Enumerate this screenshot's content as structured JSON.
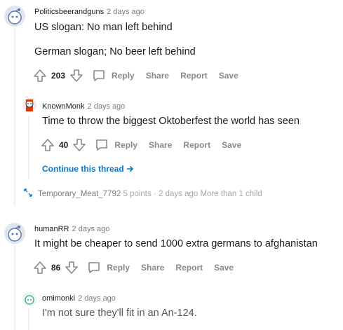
{
  "comments": [
    {
      "user": "Politicsbeerandguns",
      "time": "2 days ago",
      "body": [
        "US slogan: No man left behind",
        "German slogan; No beer left behind"
      ],
      "score": "203"
    },
    {
      "user": "KnownMonk",
      "time": "2 days ago",
      "body": [
        "Time to throw the biggest Oktoberfest the world has seen"
      ],
      "score": "40",
      "continue_label": "Continue this thread"
    },
    {
      "user": "Temporary_Meat_7792",
      "points": "5 points",
      "sep": "·",
      "time": "2 days ago",
      "extra": "More than 1 child"
    },
    {
      "user": "humanRR",
      "time": "2 days ago",
      "body": [
        "It might be cheaper to send 1000 extra germans to afghanistan"
      ],
      "score": "86"
    },
    {
      "user": "omimonki",
      "time": "2 days ago",
      "body": [
        "I'm not sure they'll fit in an An-124."
      ]
    }
  ],
  "actions": {
    "reply": "Reply",
    "share": "Share",
    "report": "Report",
    "save": "Save"
  },
  "icons": {
    "upvote": "upvote-icon",
    "downvote": "downvote-icon",
    "reply": "comment-bubble-icon",
    "expand": "expand-arrows-icon",
    "continue": "arrow-right-icon"
  },
  "colors": {
    "link": "#0079d3",
    "meta": "#7c7c7c",
    "action": "#878a8c",
    "avatar_blue": "#5c7ba8"
  }
}
